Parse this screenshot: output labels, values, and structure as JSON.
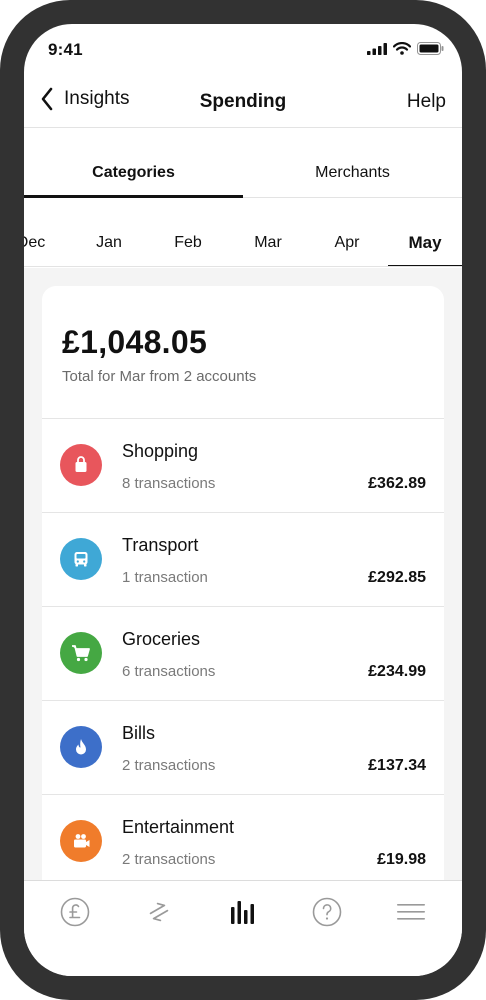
{
  "status_bar": {
    "time": "9:41"
  },
  "nav": {
    "back_label": "Insights",
    "title": "Spending",
    "help_label": "Help"
  },
  "tabs": [
    {
      "label": "Categories",
      "active": true
    },
    {
      "label": "Merchants",
      "active": false
    }
  ],
  "months": [
    {
      "label": "Dec",
      "active": false
    },
    {
      "label": "Jan",
      "active": false
    },
    {
      "label": "Feb",
      "active": false
    },
    {
      "label": "Mar",
      "active": false
    },
    {
      "label": "Apr",
      "active": false
    },
    {
      "label": "May",
      "active": true
    }
  ],
  "summary": {
    "total": "£1,048.05",
    "caption": "Total for Mar from 2 accounts"
  },
  "categories": [
    {
      "name": "Shopping",
      "count": "8 transactions",
      "amount": "£362.89",
      "icon": "shopping-bag-icon",
      "color": "#e8565c"
    },
    {
      "name": "Transport",
      "count": "1 transaction",
      "amount": "£292.85",
      "icon": "bus-icon",
      "color": "#3fa8d6"
    },
    {
      "name": "Groceries",
      "count": "6 transactions",
      "amount": "£234.99",
      "icon": "shopping-cart-icon",
      "color": "#45a843"
    },
    {
      "name": "Bills",
      "count": "2 transactions",
      "amount": "£137.34",
      "icon": "flame-icon",
      "color": "#3d6fc9"
    },
    {
      "name": "Entertainment",
      "count": "2 transactions",
      "amount": "£19.98",
      "icon": "camera-icon",
      "color": "#f07c2b"
    }
  ],
  "tab_bar": [
    {
      "icon": "pound-icon",
      "active": false
    },
    {
      "icon": "transfer-arrows-icon",
      "active": false
    },
    {
      "icon": "bar-chart-icon",
      "active": true
    },
    {
      "icon": "help-icon",
      "active": false
    },
    {
      "icon": "menu-icon",
      "active": false
    }
  ]
}
